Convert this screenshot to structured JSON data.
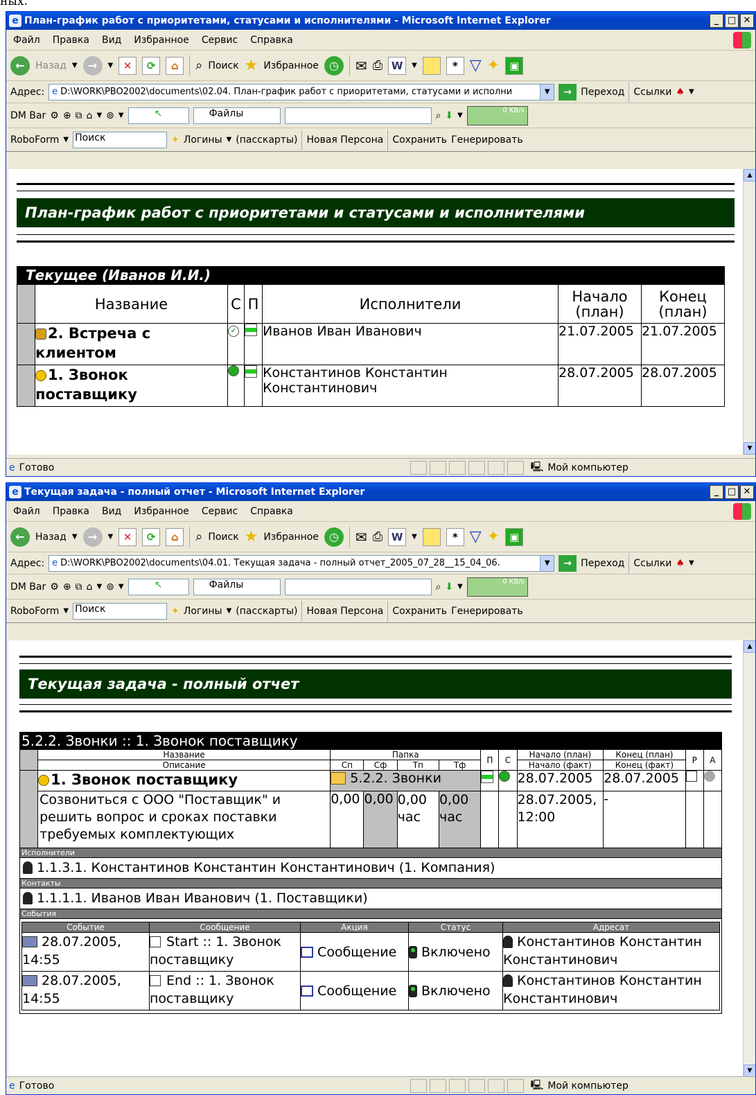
{
  "top_fragment": "ных.",
  "window1": {
    "title": "План-график работ с приоритетами, статусами и исполнителями - Microsoft Internet Explorer",
    "menu": [
      "Файл",
      "Правка",
      "Вид",
      "Избранное",
      "Сервис",
      "Справка"
    ],
    "toolbar": {
      "back": "Назад",
      "search": "Поиск",
      "favorites": "Избранное"
    },
    "address_label": "Адрес:",
    "address": "D:\\WORK\\PBO2002\\documents\\02.04. План-график работ с приоритетами, статусами и исполни",
    "go": "Переход",
    "links": "Ссылки",
    "dm_bar": "DM Bar",
    "files": "Файлы",
    "kbs": "0 KB/s",
    "roboform": {
      "name": "RoboForm",
      "search": "Поиск",
      "logins": "Логины",
      "passcards": "(пасскарты)",
      "new_person": "Новая Персона",
      "save": "Сохранить",
      "generate": "Генерировать"
    },
    "banner": "План-график работ с приоритетами и статусами и исполнителями",
    "table_title": "Текущее (Иванов И.И.)",
    "headers": {
      "name": "Название",
      "s": "С",
      "p": "П",
      "executors": "Исполнители",
      "start": "Начало (план)",
      "end": "Конец (план)"
    },
    "rows": [
      {
        "name": "2. Встреча с клиентом",
        "executor": "Иванов Иван Иванович",
        "start": "21.07.2005",
        "end": "21.07.2005"
      },
      {
        "name": "1. Звонок поставщику",
        "executor": "Константинов Константин Константинович",
        "start": "28.07.2005",
        "end": "28.07.2005"
      }
    ],
    "status": "Готово",
    "zone": "Мой компьютер"
  },
  "window2": {
    "title": "Текущая задача - полный отчет - Microsoft Internet Explorer",
    "address": "D:\\WORK\\PBO2002\\documents\\04.01. Текущая задача - полный отчет_2005_07_28__15_04_06.",
    "banner": "Текущая задача - полный отчет",
    "task_header": "5.2.2. Звонки  ::  1. Звонок поставщику",
    "headers": {
      "name": "Название",
      "desc": "Описание",
      "folder": "Папка",
      "sp": "Сп",
      "sf": "Сф",
      "tp": "Тп",
      "tf": "Тф",
      "p": "П",
      "s": "С",
      "start_plan": "Начало (план)",
      "end_plan": "Конец (план)",
      "start_fact": "Начало (факт)",
      "end_fact": "Конец (факт)",
      "r": "Р",
      "a": "А"
    },
    "task": {
      "name": "1. Звонок поставщику",
      "folder": "5.2.2. Звонки",
      "start_plan": "28.07.2005",
      "end_plan": "28.07.2005",
      "description": "Созвониться с ООО \"Поставщик\" и решить вопрос и сроках поставки требуемых комплектующих",
      "sp": "0,00",
      "sf": "0,00",
      "tp": "0,00 час",
      "tf": "0,00 час",
      "start_fact": "28.07.2005, 12:00",
      "end_fact": "-"
    },
    "executors_label": "Исполнители",
    "executor": "1.1.3.1. Константинов Константин Константинович (1. Компания)",
    "contacts_label": "Контакты",
    "contact": "1.1.1.1. Иванов Иван Иванович (1. Поставщики)",
    "events_label": "События",
    "event_headers": [
      "Событие",
      "Сообщение",
      "Акция",
      "Статус",
      "Адресат"
    ],
    "events": [
      {
        "event": "28.07.2005, 14:55",
        "message": "Start :: 1. Звонок поставщику",
        "action": "Сообщение",
        "status": "Включено",
        "addressee": "Константинов Константин Константинович"
      },
      {
        "event": "28.07.2005, 14:55",
        "message": "End :: 1. Звонок поставщику",
        "action": "Сообщение",
        "status": "Включено",
        "addressee": "Константинов Константин Константинович"
      }
    ]
  }
}
